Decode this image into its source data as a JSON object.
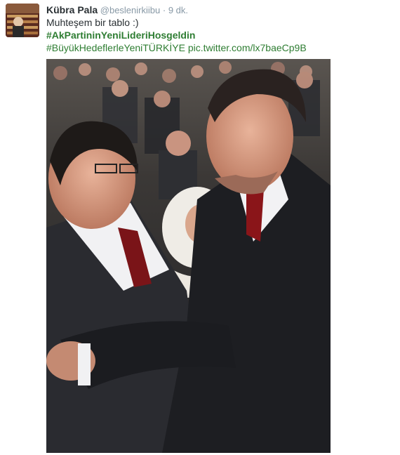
{
  "tweet": {
    "fullname": "Kübra Pala",
    "username": "@beslenirkiibu",
    "separator": "·",
    "time": "9 dk.",
    "text": "Muhteşem bir tablo :)",
    "hashtag1": "#AkPartininYeniLideriHosgeldin",
    "hashtag2": "#BüyükHedeflerleYeniTÜRKİYE",
    "link": "pic.twitter.com/lx7baeCp9B"
  },
  "colors": {
    "link_green": "#2e7d32",
    "name": "#292f33",
    "meta": "#8899a6"
  }
}
